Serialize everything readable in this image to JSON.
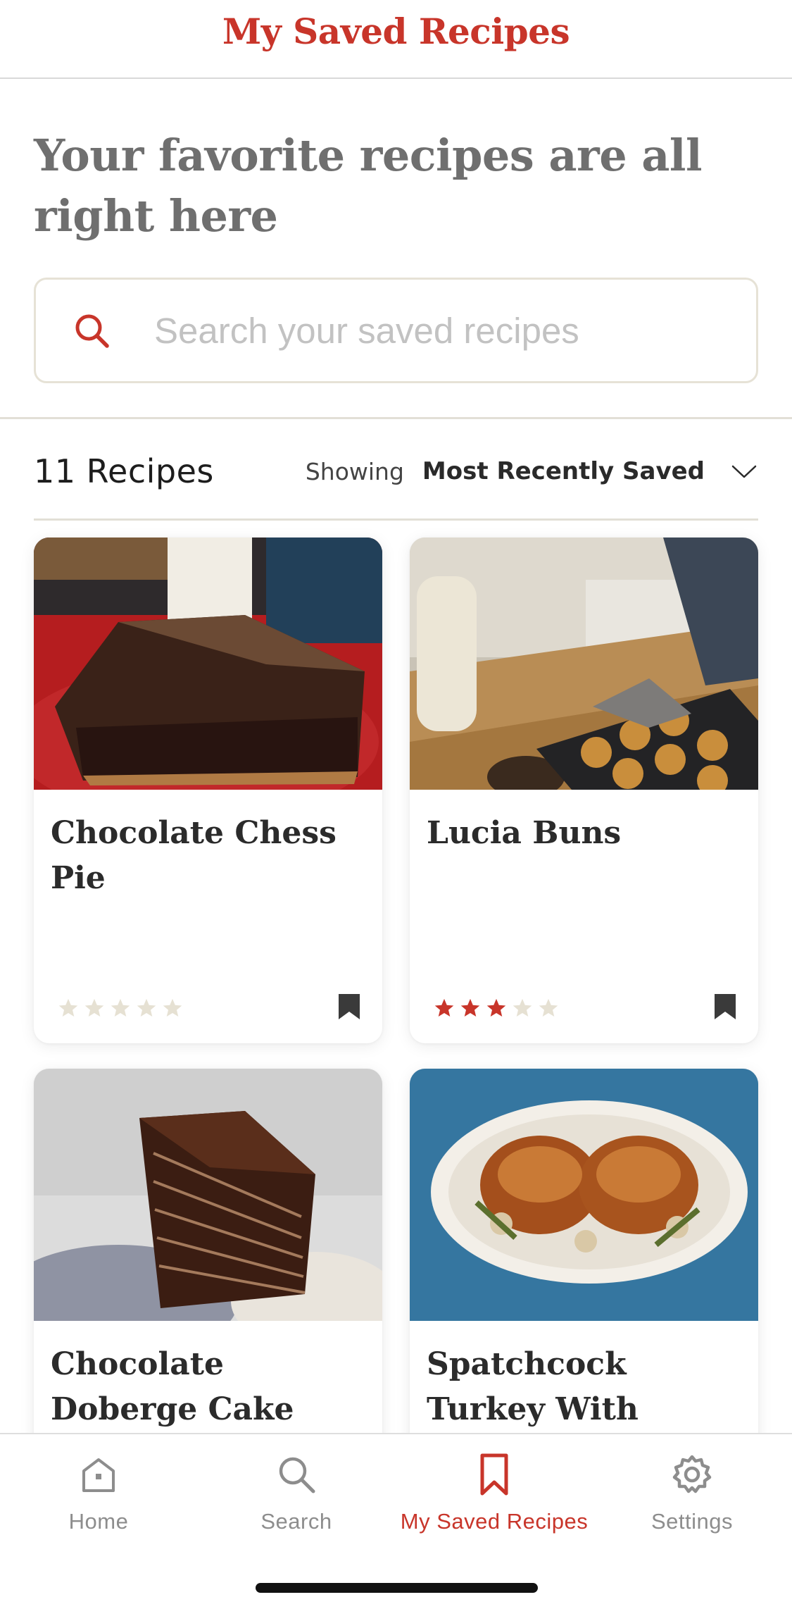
{
  "header": {
    "title": "My Saved Recipes"
  },
  "hero": {
    "title": "Your favorite recipes are all right here"
  },
  "search": {
    "placeholder": "Search your saved recipes"
  },
  "list": {
    "count_label": "11 Recipes",
    "sort_prefix": "Showing",
    "sort_value": "Most Recently Saved"
  },
  "recipes": [
    {
      "title": "Chocolate Chess Pie",
      "rating": 0,
      "rating_max": 5,
      "saved": true,
      "image": "chocolate-pie-slice-photo"
    },
    {
      "title": "Lucia Buns",
      "rating": 3,
      "rating_max": 5,
      "saved": true,
      "image": "lucia-buns-tray-photo"
    },
    {
      "title": "Chocolate Doberge Cake",
      "image": "doberge-cake-slice-photo"
    },
    {
      "title": "Spatchcock Turkey With Anise and",
      "image": "roast-turkey-platter-photo"
    }
  ],
  "colors": {
    "accent": "#c8352a",
    "star_filled": "#c8352a",
    "star_empty": "#e6e1d3",
    "muted_text": "#8d8d8d",
    "bookmark": "#3a3a3a"
  },
  "tabs": [
    {
      "label": "Home",
      "icon": "home-icon",
      "active": false
    },
    {
      "label": "Search",
      "icon": "search-icon",
      "active": false
    },
    {
      "label": "My Saved Recipes",
      "icon": "bookmark-icon",
      "active": true
    },
    {
      "label": "Settings",
      "icon": "gear-icon",
      "active": false
    }
  ]
}
